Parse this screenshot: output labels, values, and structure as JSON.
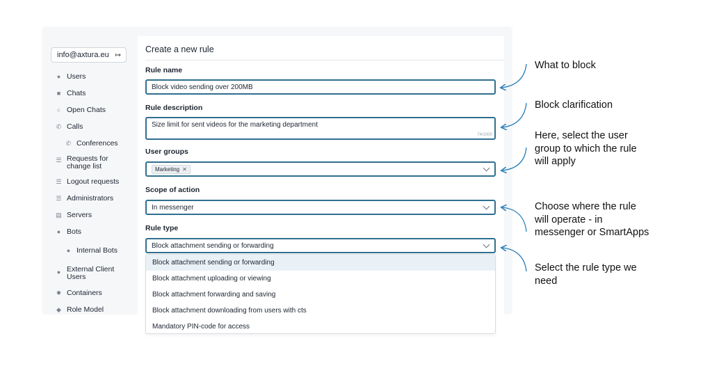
{
  "sidebar": {
    "account": "info@axtura.eu",
    "items": [
      {
        "label": "Users",
        "icon": "user-icon"
      },
      {
        "label": "Chats",
        "icon": "chat-icon"
      },
      {
        "label": "Open Chats",
        "icon": "open-chat-icon"
      },
      {
        "label": "Calls",
        "icon": "phone-icon"
      },
      {
        "label": "Conferences",
        "icon": "phone-icon"
      },
      {
        "label": "Requests for change list",
        "icon": "list-icon"
      },
      {
        "label": "Logout requests",
        "icon": "list-icon"
      },
      {
        "label": "Administrators",
        "icon": "list-icon"
      },
      {
        "label": "Servers",
        "icon": "server-icon"
      },
      {
        "label": "Bots",
        "icon": "bot-icon"
      },
      {
        "label": "Internal Bots",
        "icon": "bot-icon"
      },
      {
        "label": "External Client Users",
        "icon": "user-icon"
      },
      {
        "label": "Containers",
        "icon": "container-icon"
      },
      {
        "label": "Role Model",
        "icon": "role-icon"
      }
    ]
  },
  "form": {
    "title": "Create a new rule",
    "rule_name_label": "Rule name",
    "rule_name_value": "Block video sending over 200MB",
    "rule_desc_label": "Rule description",
    "rule_desc_value": "Size limit for sent videos for the marketing department",
    "rule_desc_counter": "74/1000",
    "user_groups_label": "User groups",
    "user_groups_tag": "Marketing",
    "scope_label": "Scope of action",
    "scope_value": "In messenger",
    "rule_type_label": "Rule type",
    "rule_type_value": "Block attachment sending or forwarding",
    "rule_type_options": [
      "Block attachment sending or forwarding",
      "Block attachment uploading or viewing",
      "Block attachment forwarding and saving",
      "Block attachment downloading from users with cts",
      "Mandatory PIN-code for access"
    ]
  },
  "annotations": {
    "what_to_block": "What to block",
    "block_clarification": "Block clarification",
    "user_group": "Here, select the user group to which the rule will apply",
    "where_operate": "Choose where the rule will operate - in messenger or SmartApps",
    "rule_type": "Select the rule type we need"
  },
  "colors": {
    "accent": "#2f6f8f",
    "selected_option": "#e9f1f7",
    "arrow": "#2a7fb8"
  }
}
